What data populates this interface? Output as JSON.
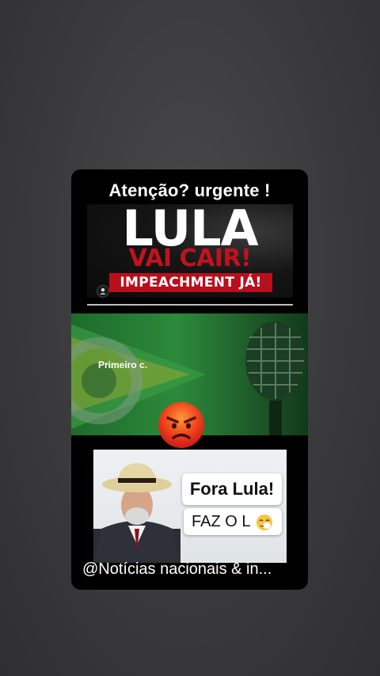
{
  "headline": "Atenção? urgente  !",
  "banner": {
    "title": "LULA",
    "subtitle": "VAI CAIR!",
    "tag": "IMPEACHMENT JÁ!"
  },
  "video": {
    "label": "Primeiro c."
  },
  "photo": {
    "bubble1": "Fora Lula!",
    "bubble2": "FAZ O L"
  },
  "footer": "@Notícias nacionais & in...",
  "colors": {
    "background": "#3a3a3c",
    "accent_red": "#c1121f",
    "flag_green": "#2c8a3a",
    "flag_yellow": "#e5c21a"
  },
  "icons": [
    "user-icon",
    "angry-face-emoji",
    "sneezing-face-emoji",
    "microphone-icon"
  ]
}
